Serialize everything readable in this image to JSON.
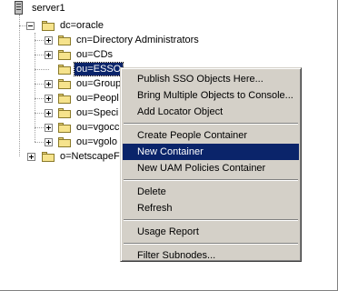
{
  "tree": {
    "root": {
      "label": "server1",
      "icon": "server-icon"
    },
    "dc": {
      "label": "dc=oracle",
      "icon": "folder-open-icon"
    },
    "children": [
      {
        "label": "cn=Directory Administrators",
        "expander": "plus"
      },
      {
        "label": "ou=CDs",
        "expander": "plus"
      },
      {
        "label": "ou=ESSO",
        "expander": "none",
        "selected": true
      },
      {
        "label": "ou=Group",
        "expander": "plus"
      },
      {
        "label": "ou=Peopl",
        "expander": "plus"
      },
      {
        "label": "ou=Speci",
        "expander": "plus"
      },
      {
        "label": "ou=vgocc",
        "expander": "plus"
      },
      {
        "label": "ou=vgolo",
        "expander": "plus"
      }
    ],
    "sibling": {
      "label": "o=NetscapeF",
      "expander": "plus"
    }
  },
  "context_menu": {
    "items": [
      {
        "label": "Publish SSO Objects Here..."
      },
      {
        "label": "Bring Multiple Objects to Console..."
      },
      {
        "label": "Add Locator Object"
      },
      {
        "separator": true
      },
      {
        "label": "Create People Container"
      },
      {
        "label": "New Container",
        "highlighted": true
      },
      {
        "label": "New UAM Policies Container"
      },
      {
        "separator": true
      },
      {
        "label": "Delete"
      },
      {
        "label": "Refresh"
      },
      {
        "separator": true
      },
      {
        "label": "Usage Report"
      },
      {
        "separator": true
      },
      {
        "label": "Filter Subnodes..."
      }
    ]
  },
  "colors": {
    "selection": "#0a246a",
    "menu_bg": "#d4d0c8",
    "folder": "#f6e38c"
  }
}
